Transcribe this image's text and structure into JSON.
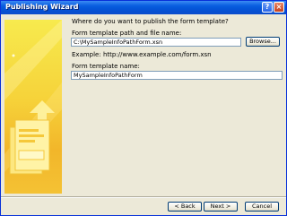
{
  "window": {
    "title": "Publishing Wizard",
    "help_glyph": "?",
    "close_glyph": "×"
  },
  "main": {
    "prompt": "Where do you want to publish the form template?",
    "path_label": "Form template path and file name:",
    "path_value": "C:\\MySampleInfoPathForm.xsn",
    "browse_label": "Browse...",
    "example_text": "Example: http://www.example.com/form.xsn",
    "name_label": "Form template name:",
    "name_value": "MySampleInfoPathForm"
  },
  "footer": {
    "back_label": "< Back",
    "next_label": "Next >",
    "cancel_label": "Cancel"
  },
  "colors": {
    "title_bar": "#0A5FE0",
    "panel_yellow": "#F6D33A",
    "dialog_bg": "#ECE9D8"
  },
  "icons": {
    "left_panel_graphic": "wizard-banner-arrow-graphic"
  }
}
